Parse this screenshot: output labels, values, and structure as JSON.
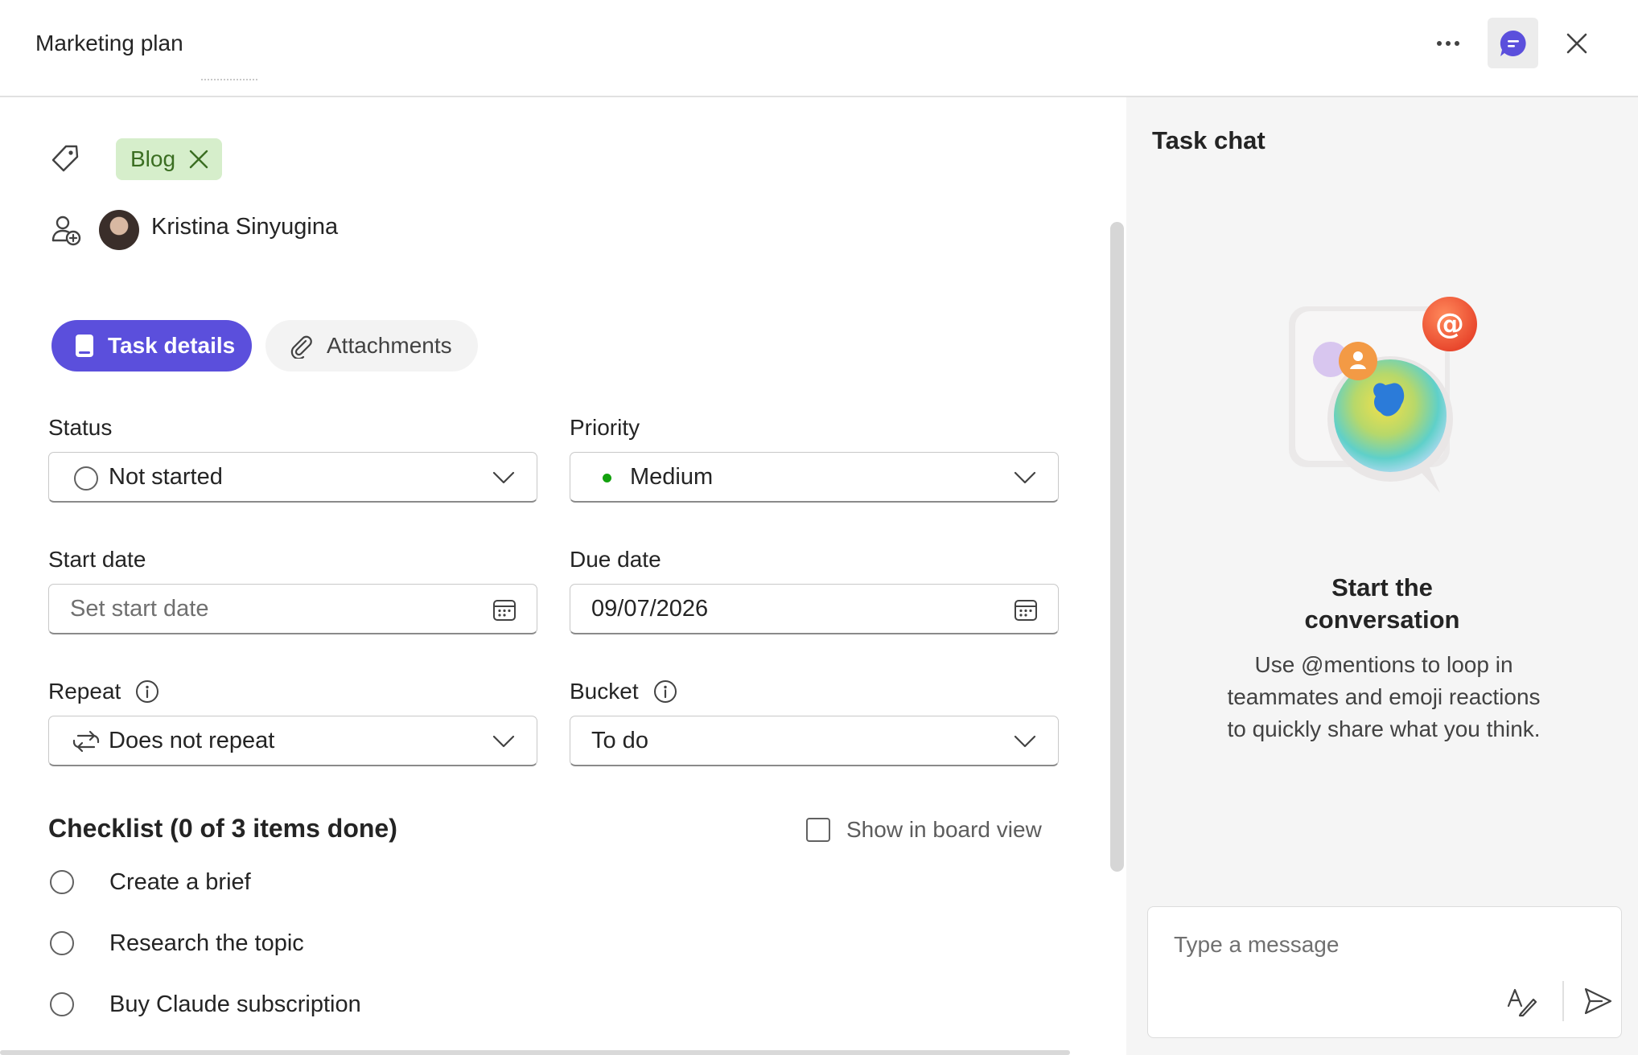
{
  "header": {
    "title": "Marketing plan"
  },
  "labels": {
    "items": [
      {
        "label": "Blog",
        "color": "#d6eecb",
        "text_color": "#3b6e22"
      }
    ]
  },
  "assignee": {
    "name": "Kristina Sinyugina"
  },
  "tabs": [
    {
      "label": "Task details",
      "active": true,
      "icon": "notebook-icon"
    },
    {
      "label": "Attachments",
      "active": false,
      "icon": "paperclip-icon"
    }
  ],
  "fields": {
    "status": {
      "label": "Status",
      "value": "Not started"
    },
    "priority": {
      "label": "Priority",
      "value": "Medium",
      "dot_color": "#13a10e"
    },
    "start_date": {
      "label": "Start date",
      "placeholder": "Set start date",
      "value": ""
    },
    "due_date": {
      "label": "Due date",
      "value": "09/07/2026"
    },
    "repeat": {
      "label": "Repeat",
      "value": "Does not repeat"
    },
    "bucket": {
      "label": "Bucket",
      "value": "To do"
    }
  },
  "checklist": {
    "title": "Checklist (0 of 3 items done)",
    "show_in_board_label": "Show in board view",
    "show_in_board": false,
    "items": [
      {
        "text": "Create a brief",
        "done": false
      },
      {
        "text": "Research the topic",
        "done": false
      },
      {
        "text": "Buy Claude subscription",
        "done": false
      }
    ]
  },
  "chat": {
    "title": "Task chat",
    "empty_heading": "Start the conversation",
    "empty_body": "Use @mentions to loop in teammates and emoji reactions to quickly share what you think.",
    "input_placeholder": "Type a message"
  },
  "colors": {
    "accent": "#5b4fdc",
    "chat_panel_bg": "#f5f5f5"
  }
}
